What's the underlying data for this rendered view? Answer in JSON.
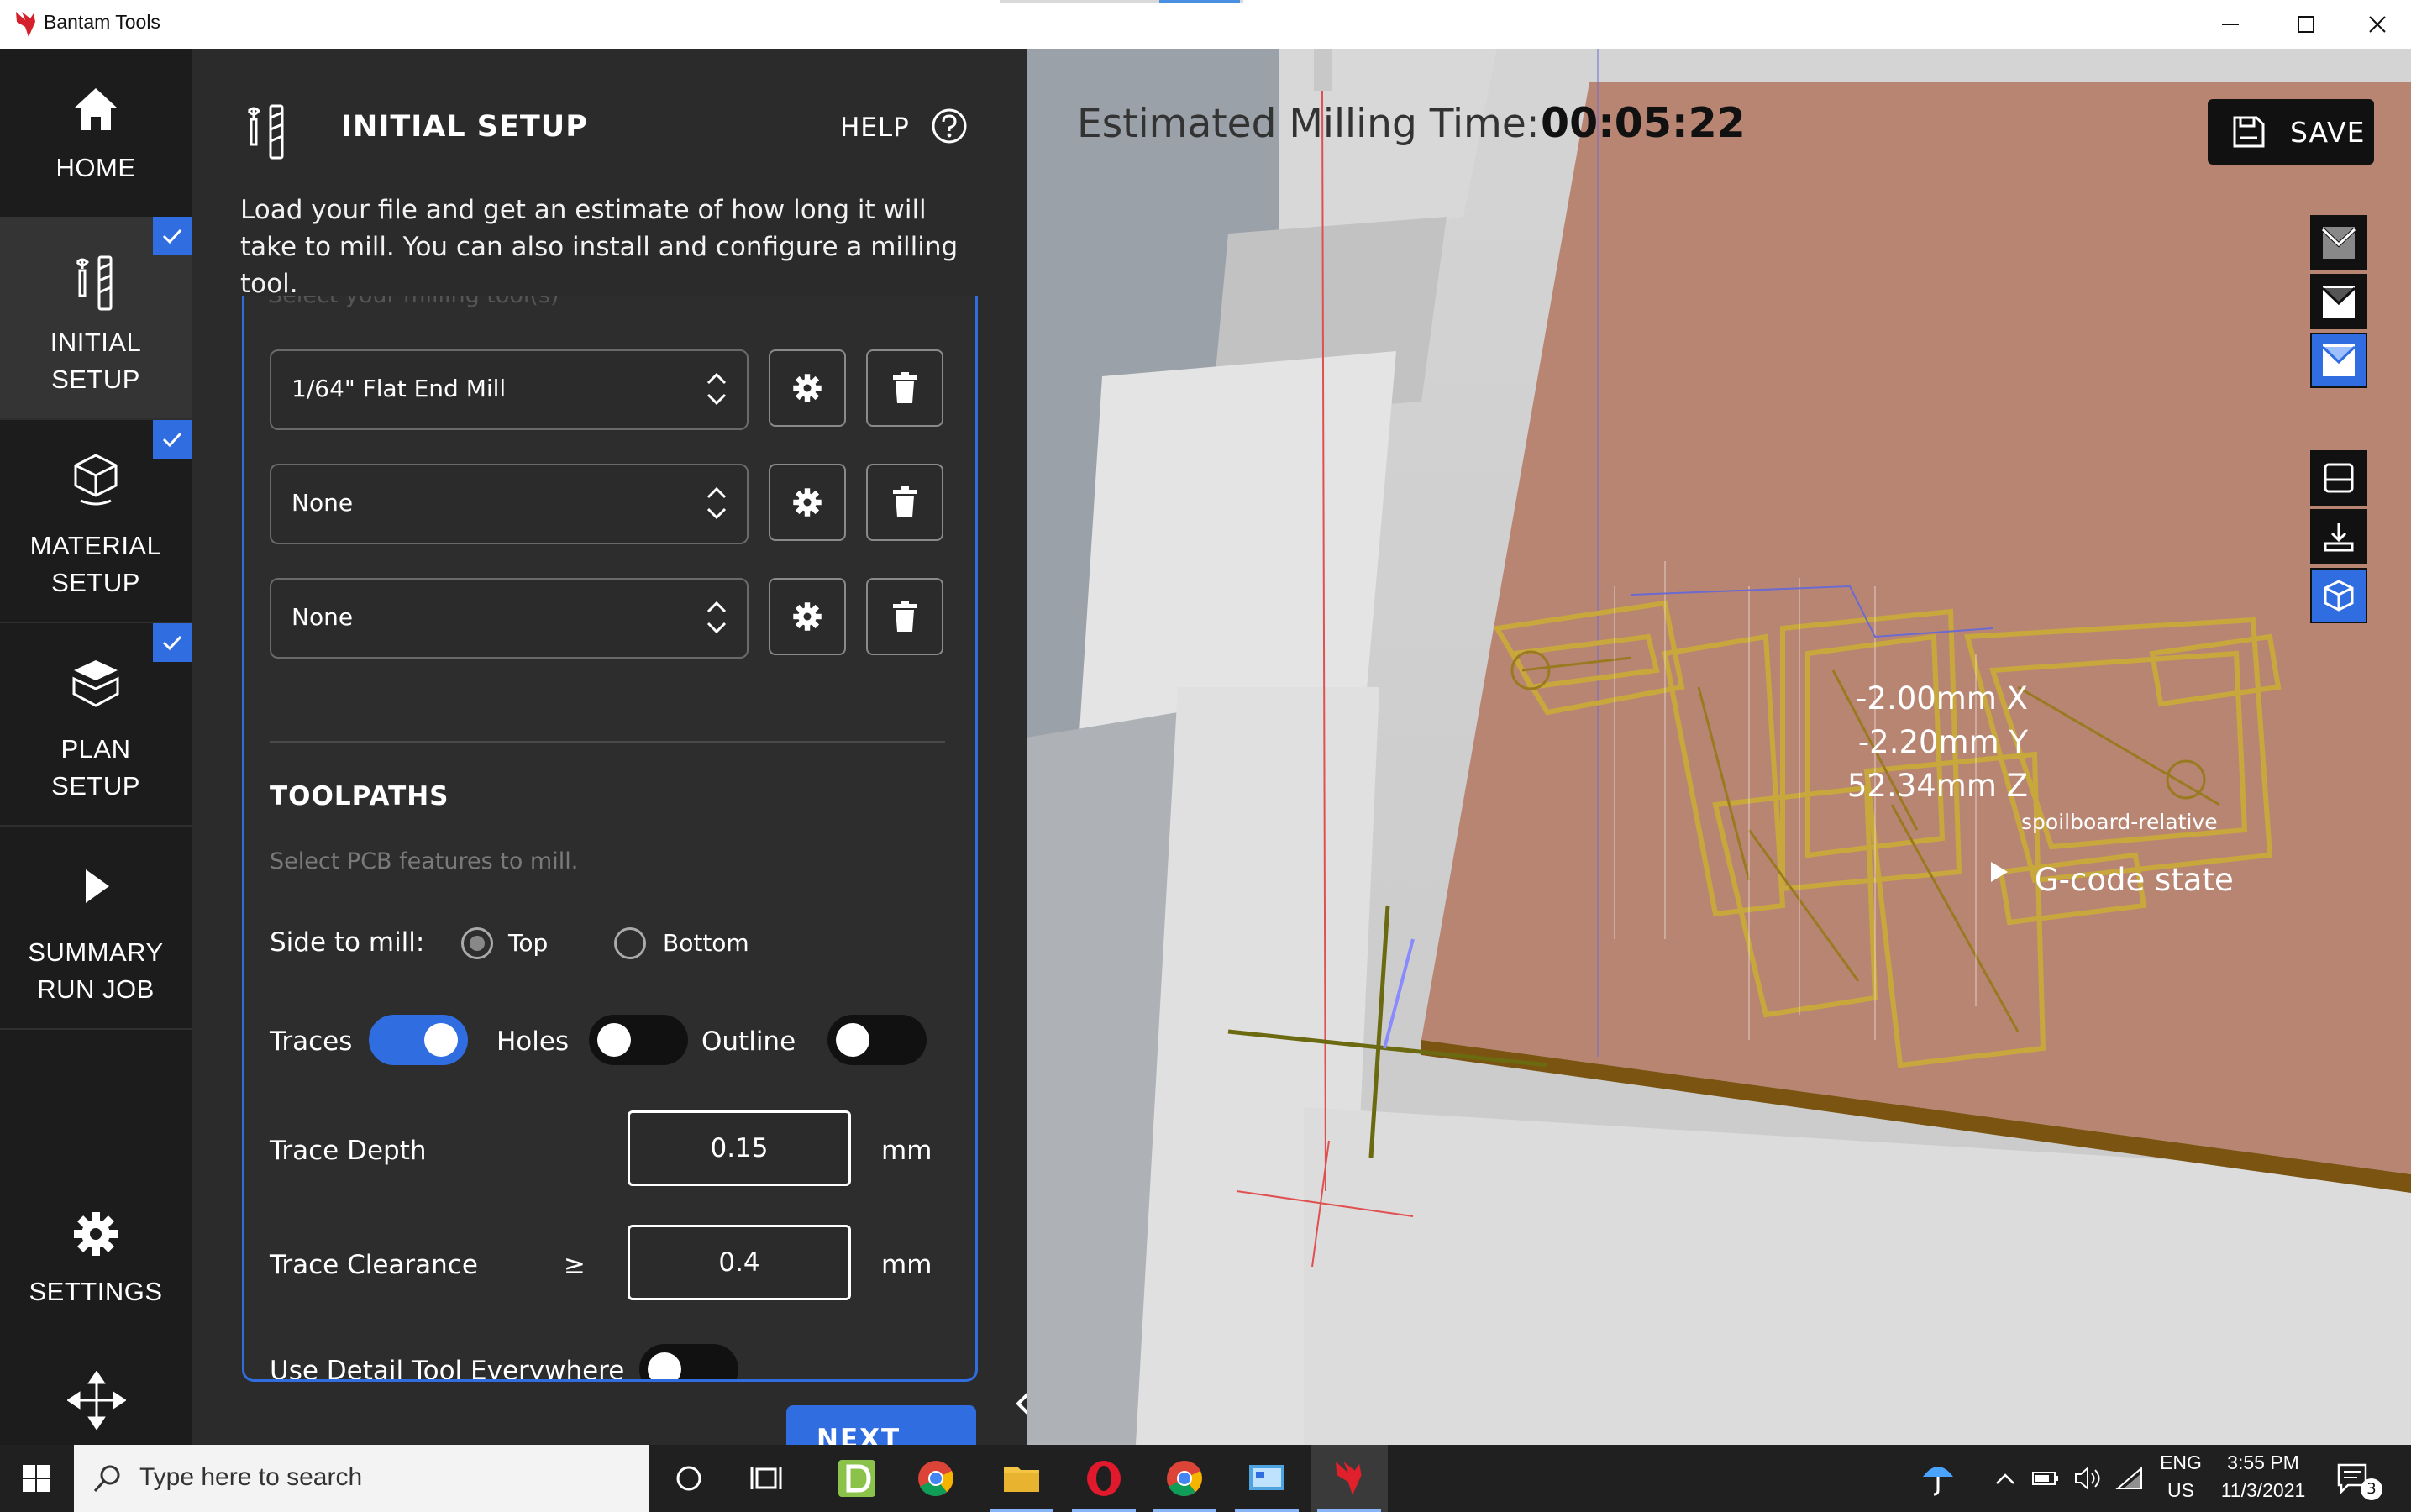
{
  "window": {
    "title": "Bantam Tools"
  },
  "nav": {
    "items": [
      {
        "line1": "HOME",
        "line2": "",
        "checked": false
      },
      {
        "line1": "INITIAL",
        "line2": "SETUP",
        "checked": true
      },
      {
        "line1": "MATERIAL",
        "line2": "SETUP",
        "checked": true
      },
      {
        "line1": "PLAN",
        "line2": "SETUP",
        "checked": true
      },
      {
        "line1": "SUMMARY",
        "line2": "RUN JOB",
        "checked": false
      }
    ],
    "settings_label": "SETTINGS"
  },
  "panel": {
    "title": "INITIAL SETUP",
    "help_label": "HELP",
    "description": "Load your file and get an estimate of how long it will take to mill. You can also install and configure a milling tool.",
    "faded_label": "Select your milling tool(s)",
    "tools": [
      {
        "value": "1/64\" Flat End Mill"
      },
      {
        "value": "None"
      },
      {
        "value": "None"
      }
    ],
    "toolpaths": {
      "heading": "TOOLPATHS",
      "hint": "Select PCB features to mill.",
      "side_label": "Side to mill:",
      "side_options": [
        "Top",
        "Bottom"
      ],
      "side_selected": "Top",
      "traces_label": "Traces",
      "traces_on": true,
      "holes_label": "Holes",
      "holes_on": false,
      "outline_label": "Outline",
      "outline_on": false,
      "trace_depth_label": "Trace Depth",
      "trace_depth_value": "0.15",
      "trace_depth_unit": "mm",
      "trace_clearance_label": "Trace Clearance",
      "trace_clearance_op": "≥",
      "trace_clearance_value": "0.4",
      "trace_clearance_unit": "mm",
      "detail_tool_label": "Use Detail Tool Everywhere",
      "detail_tool_on": false
    },
    "next_label": "NEXT"
  },
  "viewport": {
    "time_label": "Estimated Milling Time:",
    "time_value": "00:05:22",
    "save_label": "SAVE",
    "coords": {
      "x": "-2.00mm X",
      "y": "-2.20mm Y",
      "z": "52.34mm Z",
      "ref": "spoilboard-relative"
    },
    "gcode_label": "G-code state",
    "colors": {
      "material": "#b98573",
      "trace": "#c8a73c",
      "accent": "#2f6de0"
    }
  },
  "taskbar": {
    "search_placeholder": "Type here to search",
    "lang_line1": "ENG",
    "lang_line2": "US",
    "time": "3:55 PM",
    "date": "11/3/2021",
    "notif_count": "3"
  }
}
